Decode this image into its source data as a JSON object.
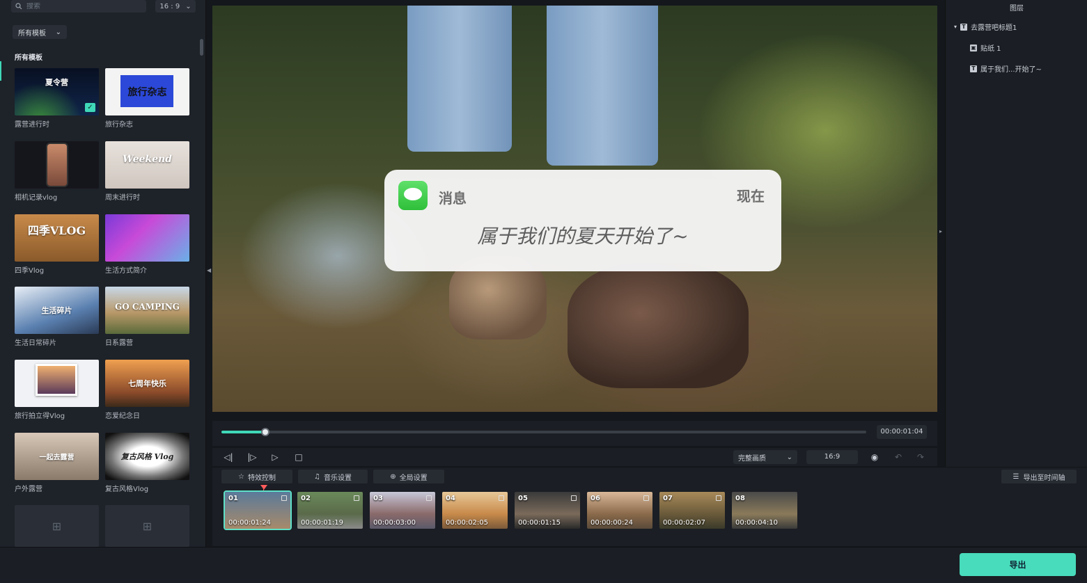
{
  "search": {
    "placeholder": "搜索"
  },
  "aspect_ratio": "16 : 9",
  "filter": {
    "selected": "所有模板"
  },
  "section_title": "所有模板",
  "templates": [
    {
      "name": "露营进行时",
      "thumb_text": "夏令营"
    },
    {
      "name": "旅行杂志",
      "thumb_text": "旅行杂志"
    },
    {
      "name": "相机记录vlog",
      "thumb_text": ""
    },
    {
      "name": "周末进行时",
      "thumb_text": "Weekend"
    },
    {
      "name": "四季Vlog",
      "thumb_text": "四季VLOG"
    },
    {
      "name": "生活方式简介",
      "thumb_text": ""
    },
    {
      "name": "生活日常碎片",
      "thumb_text": "生活碎片"
    },
    {
      "name": "日系露营",
      "thumb_text": "GO CAMPING"
    },
    {
      "name": "旅行拍立得Vlog",
      "thumb_text": ""
    },
    {
      "name": "恋爱纪念日",
      "thumb_text": "七周年快乐"
    },
    {
      "name": "户外露营",
      "thumb_text": "一起去露营"
    },
    {
      "name": "复古风格Vlog",
      "thumb_text": "复古风格 Vlog"
    }
  ],
  "notification": {
    "app": "消息",
    "time": "现在",
    "body": "属于我们的夏天开始了~"
  },
  "player": {
    "current_time": "00:00:01:04",
    "progress": 0.068,
    "quality": "完整画质",
    "ratio": "16:9"
  },
  "tabs": {
    "effects": "特效控制",
    "music": "音乐设置",
    "global": "全局设置",
    "export_timeline": "导出至时间轴"
  },
  "clips": [
    {
      "num": "01",
      "dur": "00:00:01:24"
    },
    {
      "num": "02",
      "dur": "00:00:01:19"
    },
    {
      "num": "03",
      "dur": "00:00:03:00"
    },
    {
      "num": "04",
      "dur": "00:00:02:05"
    },
    {
      "num": "05",
      "dur": "00:00:01:15"
    },
    {
      "num": "06",
      "dur": "00:00:00:24"
    },
    {
      "num": "07",
      "dur": "00:00:02:07"
    },
    {
      "num": "08",
      "dur": "00:00:04:10"
    }
  ],
  "layers": {
    "title": "图层",
    "items": [
      {
        "label": "去露营吧标题1"
      },
      {
        "label": "贴纸 1"
      },
      {
        "label": "属于我们...开始了~"
      }
    ]
  },
  "footer": {
    "export": "导出"
  },
  "colors": {
    "accent": "#3fd8b8",
    "export_button": "#48dcbc"
  }
}
